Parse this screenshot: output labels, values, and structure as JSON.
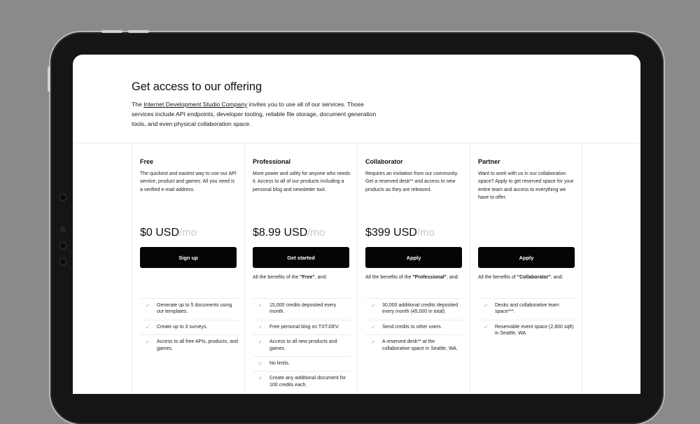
{
  "hero": {
    "title": "Get access to our offering",
    "intro_prefix": "The ",
    "company_link": "Internet Development Studio Company",
    "intro_suffix": " invites you to use all of our services. Those services include API endpoints, developer tooling, reliable file storage, document generation tools, and even physical collaboration space."
  },
  "plans": [
    {
      "name": "Free",
      "description": "The quickest and easiest way to use our API service, product and games. All you need is a verified e-mail address.",
      "price": "$0 USD",
      "per": "/mo",
      "cta": "Sign up",
      "benefits_prefix": "",
      "benefits_plan": "",
      "benefits_suffix": "",
      "features": [
        "Generate up to 5 documents using our templates.",
        "Create up to 3 surveys.",
        "Access to all free APIs, products, and games."
      ]
    },
    {
      "name": "Professional",
      "description": "More power and utility for anyone who needs it. Access to all of our products including a personal blog and newsletter tool.",
      "price": "$8.99 USD",
      "per": "/mo",
      "cta": "Get started",
      "benefits_prefix": "All the benefits of the ",
      "benefits_plan": "\"Free\"",
      "benefits_suffix": ", and:",
      "features": [
        "15,000 credits deposited every month.",
        "Free personal blog on TXT.DEV.",
        "Access to all new products and games.",
        "No limits.",
        "Create any additional document for 100 credits each."
      ]
    },
    {
      "name": "Collaborator",
      "description": "Requires an invitation from our community. Get a reserved desk** and access to new products as they are released.",
      "price": "$399 USD",
      "per": "/mo",
      "cta": "Apply",
      "benefits_prefix": "All the benefits of the ",
      "benefits_plan": "\"Professional\"",
      "benefits_suffix": ", and:",
      "features": [
        "30,000 additional credits deposited every month (45,000 in total).",
        "Send credits to other users.",
        "A reserved desk** at the collaborative space in Seattle, WA."
      ]
    },
    {
      "name": "Partner",
      "description": "Want to work with us in our collaboration space? Apply to get reserved space for your entire team and access to everything we have to offer.",
      "price": "",
      "per": "",
      "cta": "Apply",
      "benefits_prefix": "All the benefits of ",
      "benefits_plan": "\"Collaborator\"",
      "benefits_suffix": ", and:",
      "features": [
        "Desks and collaborative team space***.",
        "Reservable event space (2,800 sqft) in Seattle, WA."
      ]
    }
  ],
  "colors": {
    "background": "#8a8a8a",
    "button": "#050505",
    "check": "#6bbf8a",
    "price_suffix": "#c9c9c9"
  },
  "icons": {
    "feature": "check-icon",
    "feature_glyph": "✓"
  }
}
